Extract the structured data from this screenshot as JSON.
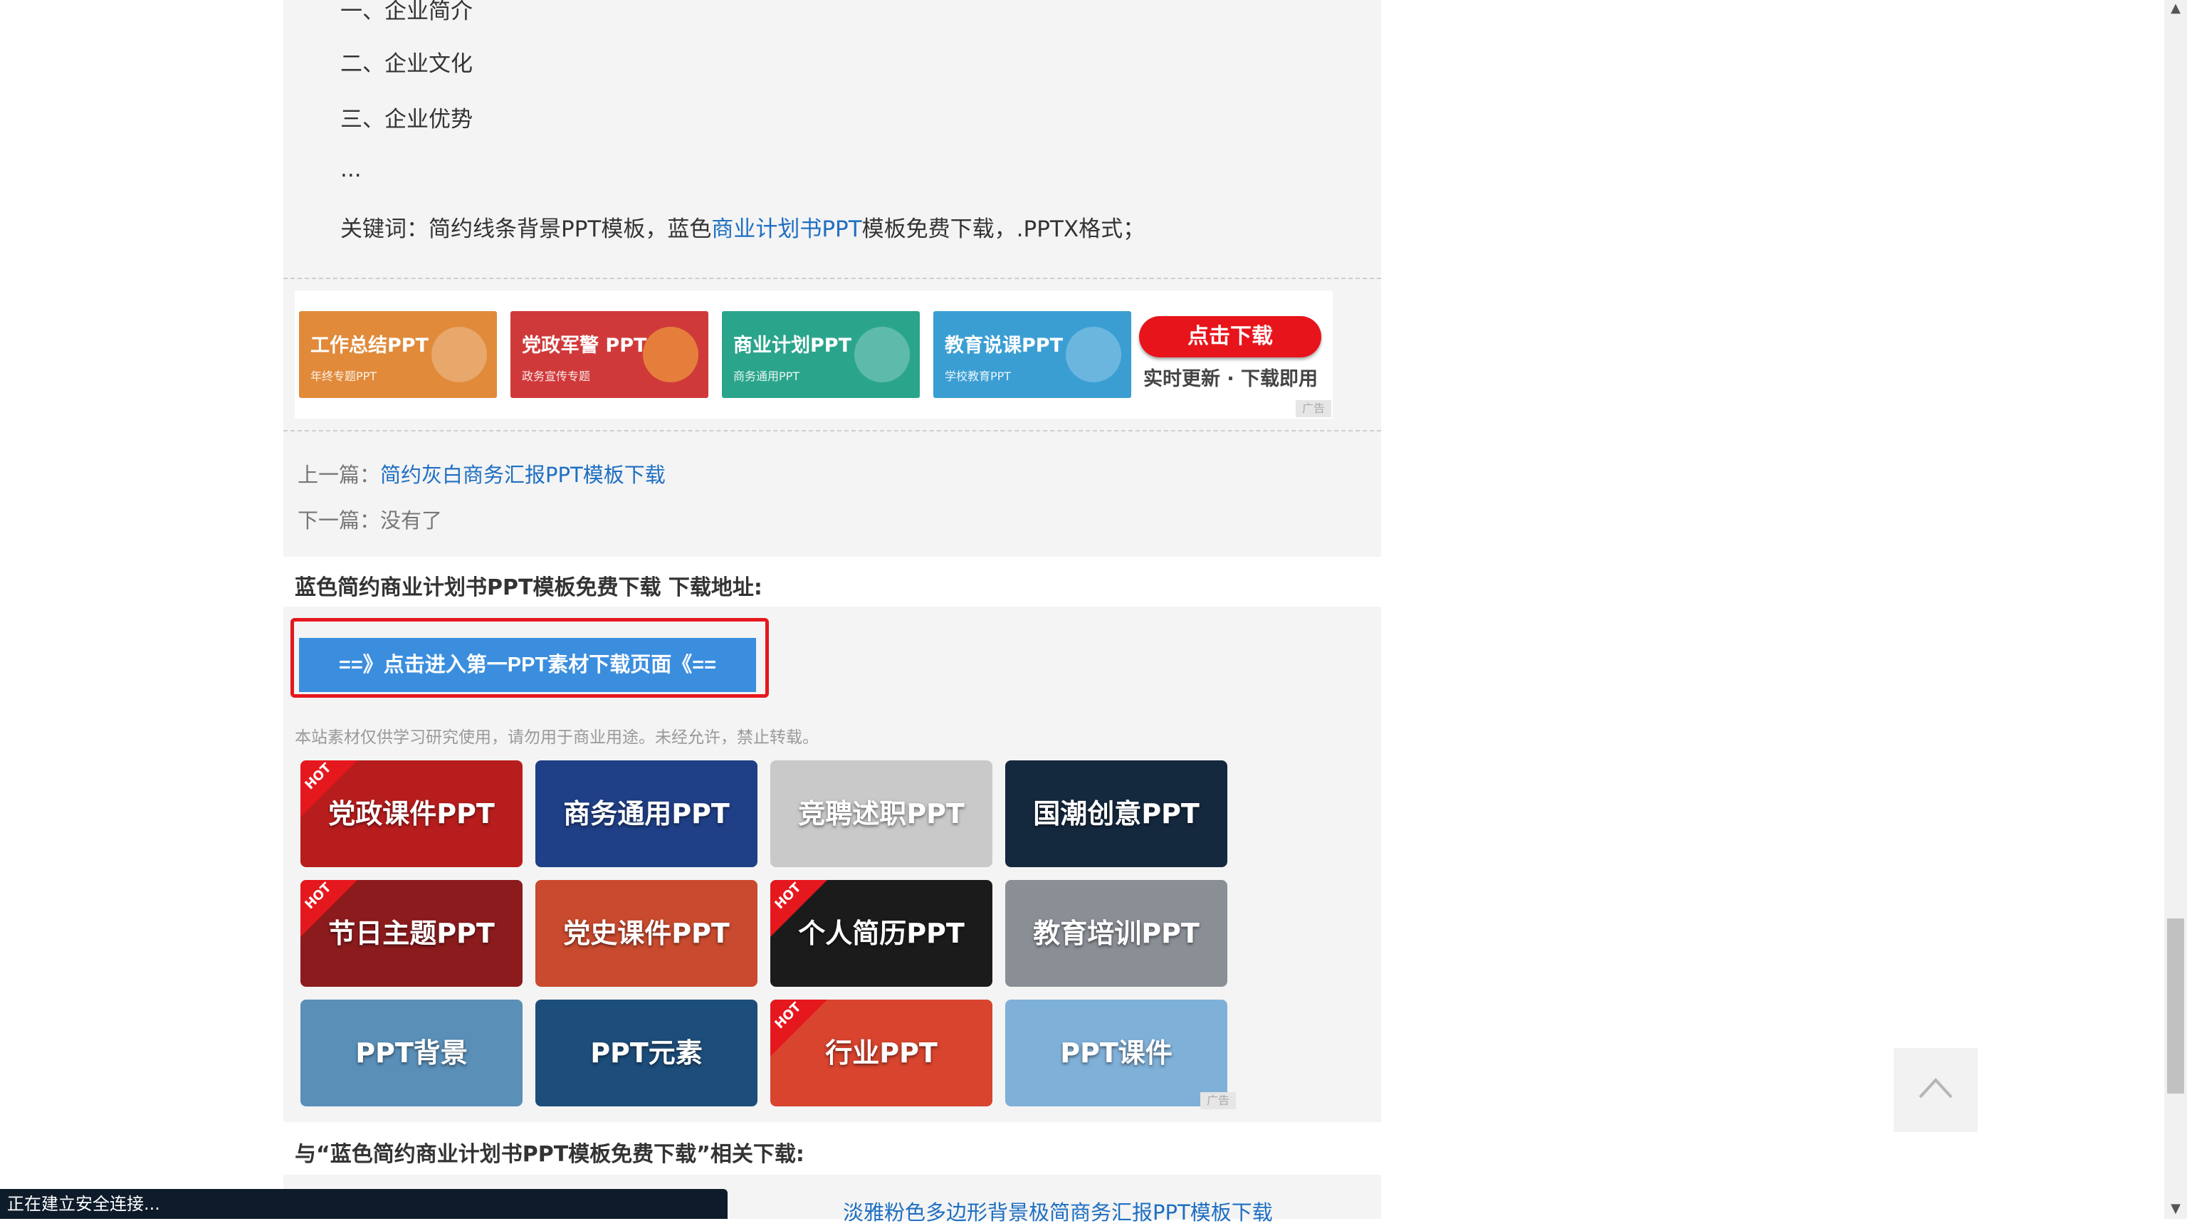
{
  "article": {
    "toc": [
      "一、企业简介",
      "二、企业文化",
      "三、企业优势",
      "..."
    ],
    "keywords_prefix": "关键词：简约线条背景PPT模板，蓝色",
    "keywords_link": "商业计划书PPT",
    "keywords_suffix": "模板免费下载，.PPTX格式；"
  },
  "banner_ads": {
    "items": [
      {
        "title": "工作总结PPT",
        "sub": "年终专题PPT",
        "color": "#e08a3a"
      },
      {
        "title": "党政军警 PPT",
        "sub": "政务宣传专题",
        "color": "#d0393a"
      },
      {
        "title": "商业计划PPT",
        "sub": "商务通用PPT",
        "color": "#2aa58c"
      },
      {
        "title": "教育说课PPT",
        "sub": "学校教育PPT",
        "color": "#3a9ed3"
      }
    ],
    "download_button": "点击下载",
    "download_sub": "实时更新 · 下载即用",
    "ad_label": "广告"
  },
  "nav": {
    "prev_label": "上一篇：",
    "prev_link": "简约灰白商务汇报PPT模板下载",
    "next_label": "下一篇：",
    "next_value": "没有了"
  },
  "download": {
    "section_title": "蓝色简约商业计划书PPT模板免费下载 下载地址:",
    "button_label": "==》点击进入第一PPT素材下载页面《==",
    "notice": "本站素材仅供学习研究使用，请勿用于商业用途。未经允许，禁止转载。"
  },
  "tiles": [
    {
      "label": "党政课件PPT",
      "hot": true,
      "color": "#b81d1d"
    },
    {
      "label": "商务通用PPT",
      "hot": false,
      "color": "#1f3f86"
    },
    {
      "label": "竞聘述职PPT",
      "hot": false,
      "color": "#c9c9c9"
    },
    {
      "label": "国潮创意PPT",
      "hot": false,
      "color": "#14283e"
    },
    {
      "label": "节日主题PPT",
      "hot": true,
      "color": "#8c1b1d"
    },
    {
      "label": "党史课件PPT",
      "hot": false,
      "color": "#c94a2e"
    },
    {
      "label": "个人简历PPT",
      "hot": true,
      "color": "#1b1b1b"
    },
    {
      "label": "教育培训PPT",
      "hot": false,
      "color": "#8a8f96"
    },
    {
      "label": "PPT背景",
      "hot": false,
      "color": "#5a8fb8"
    },
    {
      "label": "PPT元素",
      "hot": false,
      "color": "#1d4d7a"
    },
    {
      "label": "行业PPT",
      "hot": true,
      "color": "#d8442e"
    },
    {
      "label": "PPT课件",
      "hot": false,
      "color": "#7fb0d8"
    }
  ],
  "hot_label": "HOT",
  "tiles_ad_label": "广告",
  "related": {
    "title": "与“蓝色简约商业计划书PPT模板免费下载”相关下载:",
    "first_link": "淡雅粉色多边形背景极简商务汇报PPT模板下载"
  },
  "status_text": "正在建立安全连接..."
}
